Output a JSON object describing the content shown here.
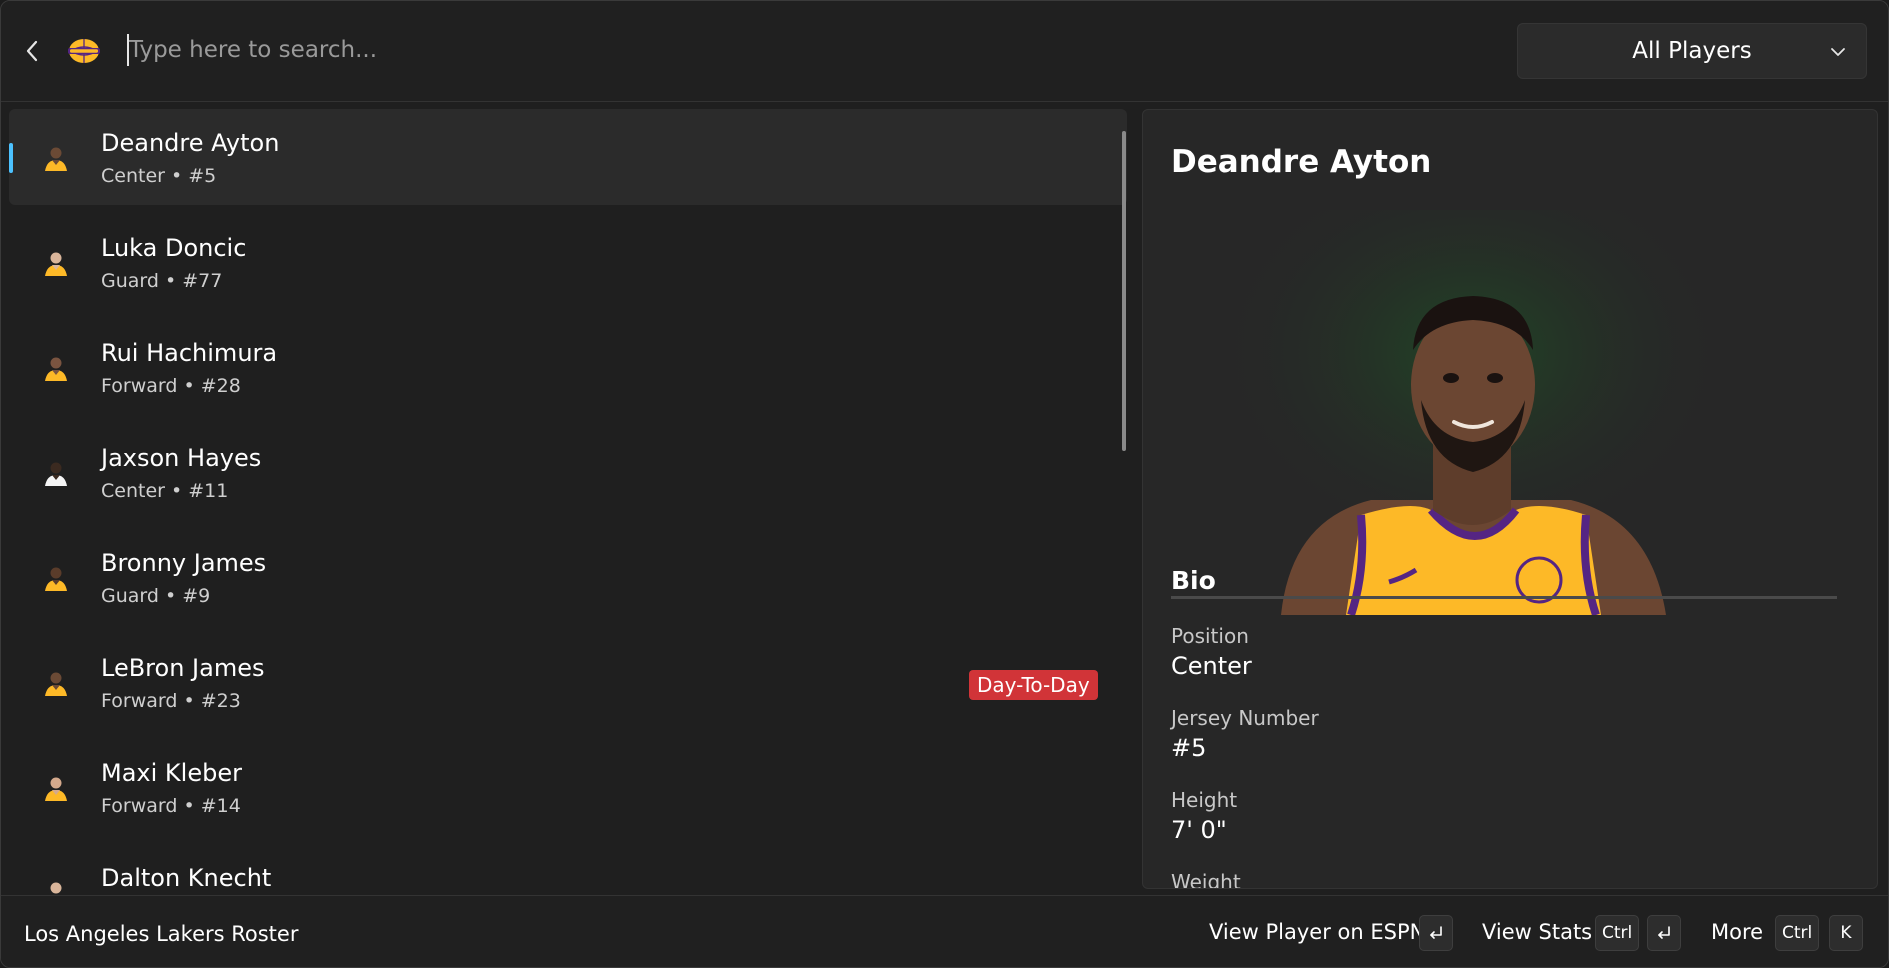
{
  "search": {
    "placeholder": "Type here to search...",
    "value": ""
  },
  "filter": {
    "selected": "All Players"
  },
  "players": [
    {
      "name": "Deandre Ayton",
      "meta": "Center • #5",
      "selected": true,
      "tag": ""
    },
    {
      "name": "Luka Doncic",
      "meta": "Guard • #77",
      "selected": false,
      "tag": ""
    },
    {
      "name": "Rui Hachimura",
      "meta": "Forward • #28",
      "selected": false,
      "tag": ""
    },
    {
      "name": "Jaxson Hayes",
      "meta": "Center • #11",
      "selected": false,
      "tag": ""
    },
    {
      "name": "Bronny James",
      "meta": "Guard • #9",
      "selected": false,
      "tag": ""
    },
    {
      "name": "LeBron James",
      "meta": "Forward • #23",
      "selected": false,
      "tag": "Day-To-Day"
    },
    {
      "name": "Maxi Kleber",
      "meta": "Forward • #14",
      "selected": false,
      "tag": ""
    },
    {
      "name": "Dalton Knecht",
      "meta": "",
      "selected": false,
      "tag": ""
    }
  ],
  "details": {
    "title": "Deandre Ayton",
    "bio_heading": "Bio",
    "fields": [
      {
        "label": "Position",
        "value": "Center"
      },
      {
        "label": "Jersey Number",
        "value": "#5"
      },
      {
        "label": "Height",
        "value": "7' 0\""
      },
      {
        "label": "Weight",
        "value": ""
      }
    ]
  },
  "footer": {
    "title": "Los Angeles Lakers Roster",
    "actions": {
      "view_espn": "View Player on ESPN",
      "view_stats": "View Stats",
      "more": "More"
    },
    "keys": {
      "ctrl": "Ctrl",
      "k": "K"
    }
  },
  "colors": {
    "accent": "#4cc2ff",
    "tag_red": "#d13438",
    "lakers_gold": "#fdb927",
    "lakers_purple": "#552583"
  }
}
